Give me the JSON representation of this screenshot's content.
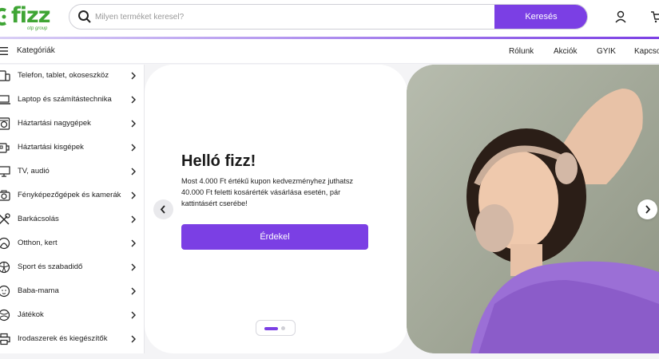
{
  "header": {
    "logo_text": "fizz",
    "logo_sub": "otp group",
    "search": {
      "placeholder": "Milyen terméket keresel?",
      "button_label": "Keresés"
    },
    "icons": [
      "search-icon",
      "user-icon",
      "cart-icon"
    ]
  },
  "nav": {
    "categories_label": "Kategóriák",
    "links": [
      "Rólunk",
      "Akciók",
      "GYIK",
      "Kapcsolat"
    ]
  },
  "categories": [
    {
      "label": "Telefon, tablet, okoseszköz",
      "icon": "phone-tablet-icon"
    },
    {
      "label": "Laptop és számítástechnika",
      "icon": "laptop-icon"
    },
    {
      "label": "Háztartási nagygépek",
      "icon": "washing-machine-icon"
    },
    {
      "label": "Háztartási kisgépek",
      "icon": "kettle-icon"
    },
    {
      "label": "TV, audió",
      "icon": "tv-icon"
    },
    {
      "label": "Fényképezőgépek és kamerák",
      "icon": "camera-icon"
    },
    {
      "label": "Barkácsolás",
      "icon": "tools-icon"
    },
    {
      "label": "Otthon, kert",
      "icon": "home-garden-icon"
    },
    {
      "label": "Sport és szabadidő",
      "icon": "ball-icon"
    },
    {
      "label": "Baba-mama",
      "icon": "baby-icon"
    },
    {
      "label": "Játékok",
      "icon": "toy-icon"
    },
    {
      "label": "Irodaszerek és kiegészítők",
      "icon": "printer-icon"
    }
  ],
  "banner": {
    "title": "Helló fizz!",
    "text": "Most 4.000 Ft értékű kupon kedvezményhez juthatsz 40.000 Ft feletti kosárérték vásárlása esetén, pár kattintásért cserébe!",
    "cta_label": "Érdekel",
    "slides_total": 2,
    "active_slide": 1
  },
  "colors": {
    "brand_green": "#3fa535",
    "accent_purple": "#7b3fe4"
  }
}
